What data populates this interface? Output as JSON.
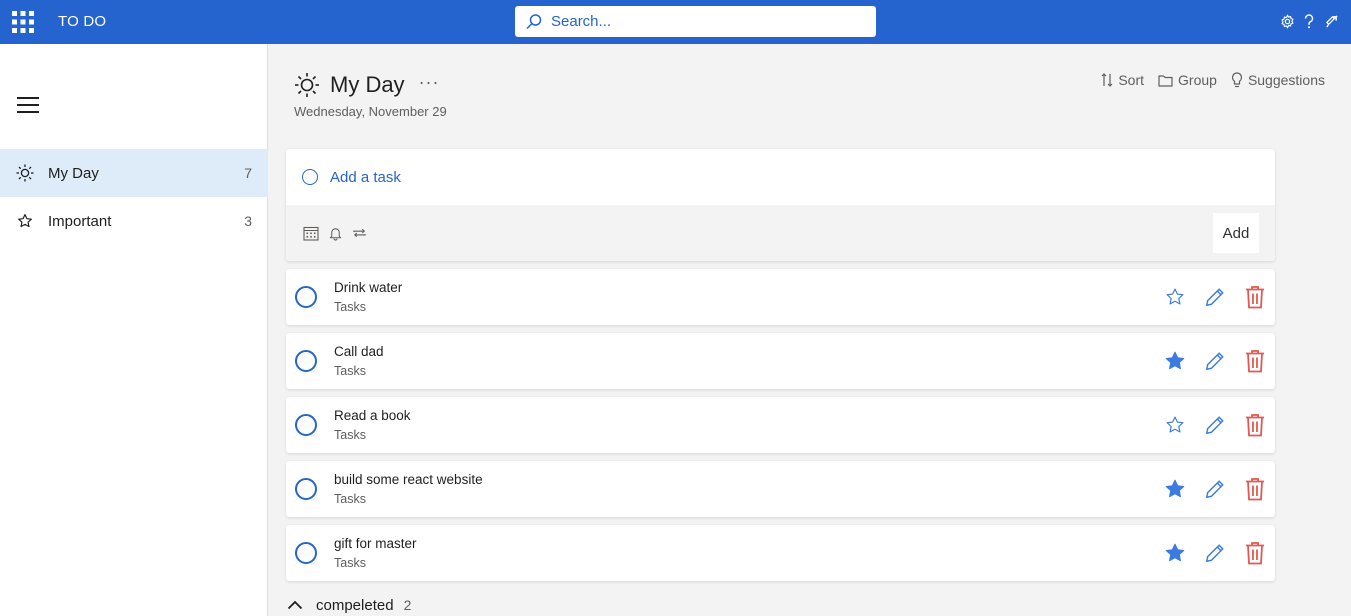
{
  "app": {
    "title": "TO DO"
  },
  "search": {
    "placeholder": "Search..."
  },
  "sidebar": {
    "items": [
      {
        "label": "My Day",
        "count": "7",
        "icon": "sun-icon",
        "active": true
      },
      {
        "label": "Important",
        "count": "3",
        "icon": "star-outline-icon",
        "active": false
      }
    ]
  },
  "header": {
    "title": "My Day",
    "more": "···",
    "date": "Wednesday, November 29",
    "sort_label": "Sort",
    "group_label": "Group",
    "suggestions_label": "Suggestions"
  },
  "add_task": {
    "placeholder": "Add a task",
    "add_label": "Add"
  },
  "tasks": [
    {
      "title": "Drink water",
      "list": "Tasks",
      "important": false
    },
    {
      "title": "Call dad",
      "list": "Tasks",
      "important": true
    },
    {
      "title": "Read a book",
      "list": "Tasks",
      "important": false
    },
    {
      "title": "build some react website",
      "list": "Tasks",
      "important": true
    },
    {
      "title": "gift for master",
      "list": "Tasks",
      "important": true
    }
  ],
  "completed": {
    "label": "compeleted",
    "count": "2"
  },
  "colors": {
    "accent": "#2564cf",
    "star": "#3b7be0",
    "delete": "#e05a52",
    "active_nav": "#deecf9"
  }
}
